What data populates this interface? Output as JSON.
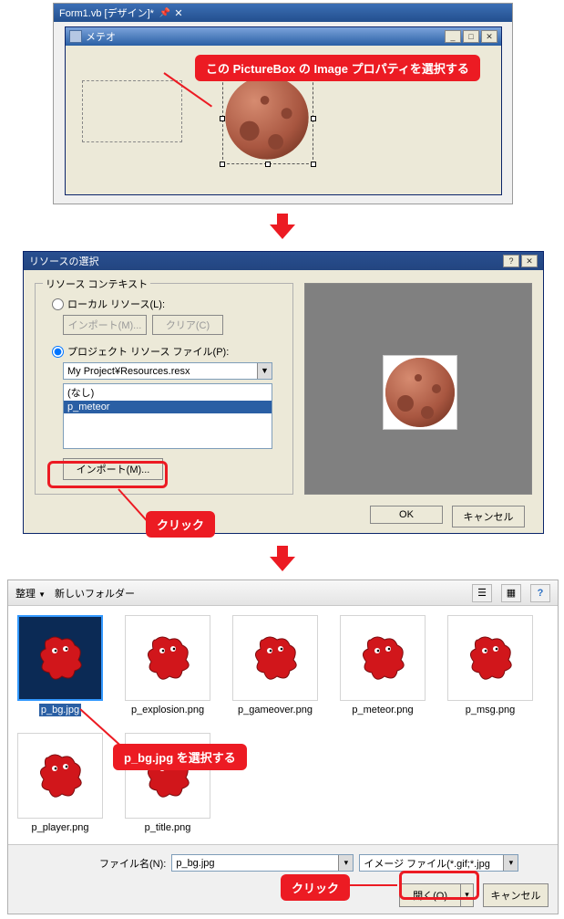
{
  "panel1": {
    "tab_label": "Form1.vb [デザイン]*",
    "form_title": "メテオ",
    "callout": "この PictureBox の Image プロパティを選択する"
  },
  "panel2": {
    "title": "リソースの選択",
    "group_legend": "リソース コンテキスト",
    "radio_local": "ローカル リソース(L):",
    "btn_import_disabled": "インポート(M)...",
    "btn_clear_disabled": "クリア(C)",
    "radio_project": "プロジェクト リソース ファイル(P):",
    "resx_path": "My Project¥Resources.resx",
    "list_none": "(なし)",
    "list_item": "p_meteor",
    "btn_import": "インポート(M)...",
    "btn_ok": "OK",
    "btn_cancel": "キャンセル",
    "callout_click": "クリック"
  },
  "panel3": {
    "toolbar_organize": "整理",
    "toolbar_newfolder": "新しいフォルダー",
    "thumbs": [
      "p_bg.jpg",
      "p_explosion.png",
      "p_gameover.png",
      "p_meteor.png",
      "p_msg.png",
      "p_player.png",
      "p_title.png"
    ],
    "callout_select": "p_bg.jpg を選択する",
    "filename_label": "ファイル名(N):",
    "filename_value": "p_bg.jpg",
    "filter_value": "イメージ ファイル(*.gif;*.jpg",
    "btn_open": "開く(O)",
    "btn_cancel": "キャンセル",
    "callout_click": "クリック"
  }
}
